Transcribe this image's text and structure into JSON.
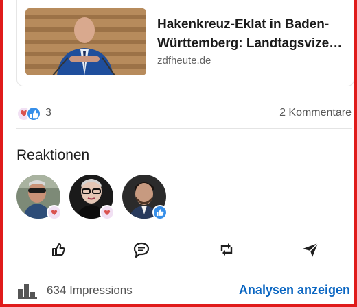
{
  "article": {
    "title": "Hakenkreuz-Eklat in Baden-Württemberg: Landtagsvize…",
    "source": "zdfheute.de"
  },
  "social": {
    "reaction_count": "3",
    "comments": "2 Kommentare",
    "reaction_icons": [
      "heart-hand-icon",
      "thumbs-up-icon"
    ]
  },
  "reactions": {
    "title": "Reaktionen",
    "people": [
      {
        "avatar": "avatar-man-sunglasses",
        "reaction": "heart-hand-icon"
      },
      {
        "avatar": "avatar-woman-glasses",
        "reaction": "heart-hand-icon"
      },
      {
        "avatar": "avatar-man-beard",
        "reaction": "thumbs-up-icon"
      }
    ]
  },
  "actions": [
    "like-icon",
    "comment-icon",
    "repost-icon",
    "send-icon"
  ],
  "footer": {
    "impressions": "634 Impressions",
    "analytics": "Analysen anzeigen"
  },
  "colors": {
    "accent": "#0a66c2",
    "frame": "#e01b1b",
    "heart_badge": "#c37bc4",
    "like_badge": "#378fe9"
  }
}
